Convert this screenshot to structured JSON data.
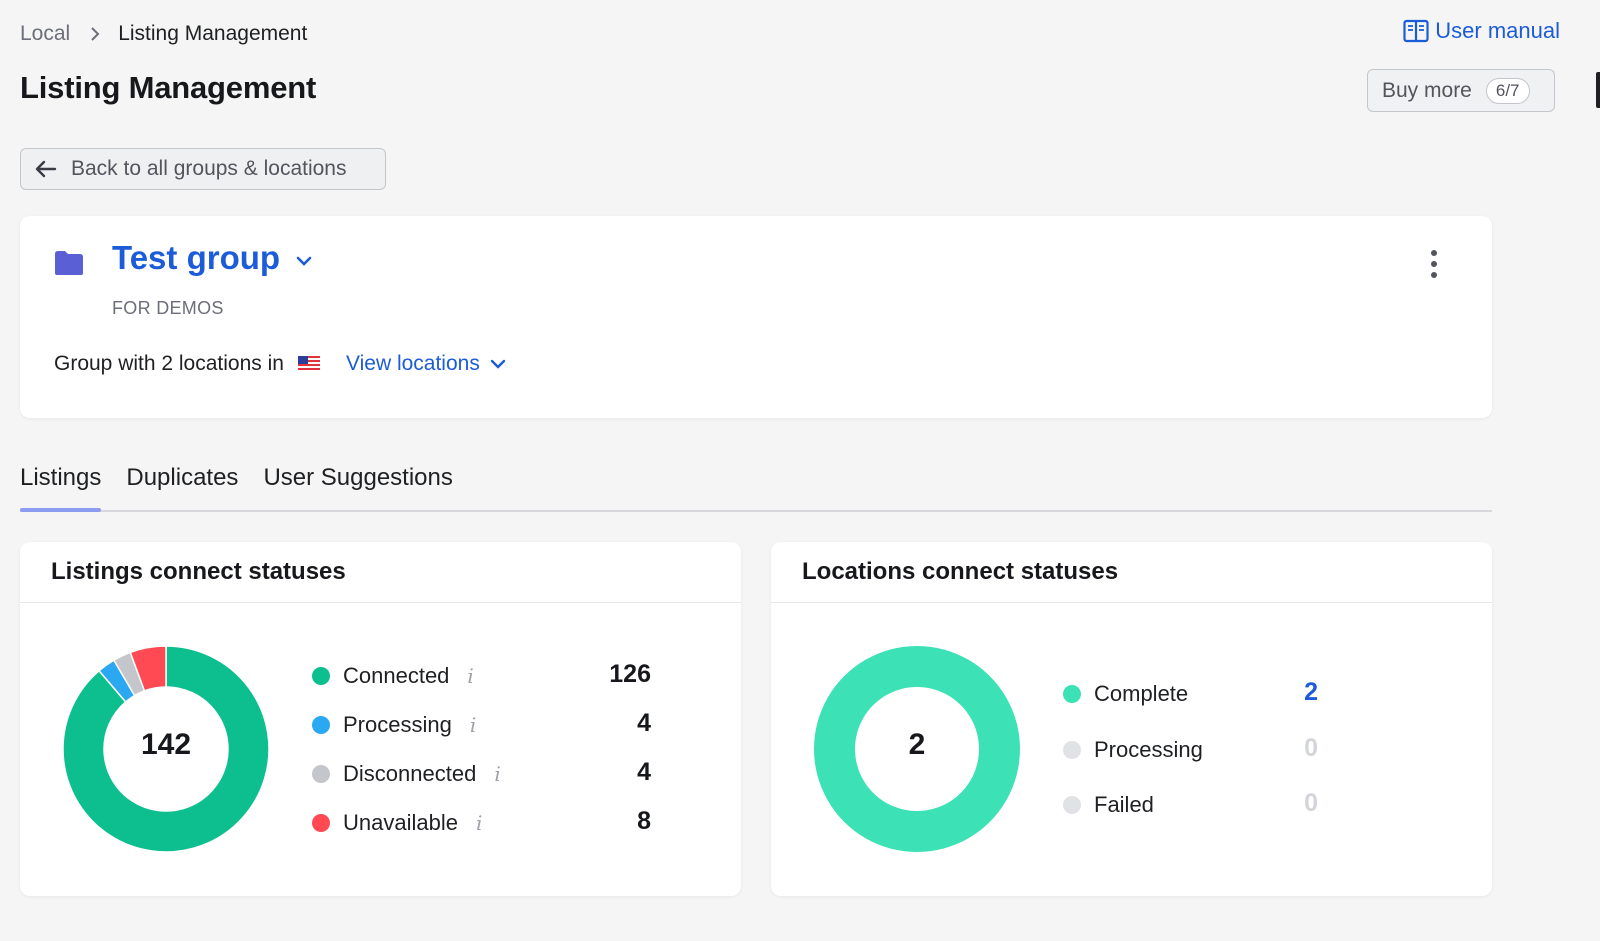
{
  "breadcrumb": {
    "parent": "Local",
    "current": "Listing Management"
  },
  "user_manual": {
    "label": "User manual",
    "icon": "book-icon"
  },
  "page": {
    "title": "Listing Management"
  },
  "buy_more": {
    "label": "Buy more",
    "count": "6/7"
  },
  "back_button": {
    "label": "Back to all groups & locations",
    "icon": "arrow-left-icon"
  },
  "group": {
    "name": "Test group",
    "subtitle": "FOR DEMOS",
    "description": "Group with 2 locations in",
    "view_locations": "View locations",
    "folder_color": "#5b5fd6"
  },
  "tabs": [
    {
      "label": "Listings",
      "active": true
    },
    {
      "label": "Duplicates",
      "active": false
    },
    {
      "label": "User Suggestions",
      "active": false
    }
  ],
  "listings_card": {
    "title": "Listings connect statuses",
    "total": "142",
    "items": [
      {
        "label": "Connected",
        "value": "126",
        "color": "#0dbf8f"
      },
      {
        "label": "Processing",
        "value": "4",
        "color": "#2aa8f2"
      },
      {
        "label": "Disconnected",
        "value": "4",
        "color": "#c4c6cb"
      },
      {
        "label": "Unavailable",
        "value": "8",
        "color": "#ff4953"
      }
    ]
  },
  "locations_card": {
    "title": "Locations connect statuses",
    "total": "2",
    "items": [
      {
        "label": "Complete",
        "value": "2",
        "color": "#3ce1b5"
      },
      {
        "label": "Processing",
        "value": "0",
        "color": "#e1e2e5"
      },
      {
        "label": "Failed",
        "value": "0",
        "color": "#e1e2e5"
      }
    ]
  }
}
